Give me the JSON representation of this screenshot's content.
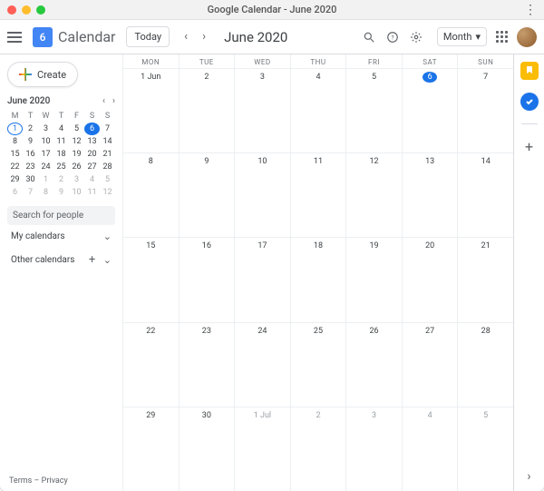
{
  "window": {
    "title": "Google Calendar - June 2020"
  },
  "header": {
    "logo_day": "6",
    "app_name": "Calendar",
    "today_label": "Today",
    "month_title": "June 2020",
    "view_label": "Month"
  },
  "create": {
    "label": "Create"
  },
  "mini": {
    "month_label": "June 2020",
    "dow": [
      "M",
      "T",
      "W",
      "T",
      "F",
      "S",
      "S"
    ],
    "cells": [
      {
        "n": "1",
        "type": "today-outline"
      },
      {
        "n": "2"
      },
      {
        "n": "3"
      },
      {
        "n": "4"
      },
      {
        "n": "5"
      },
      {
        "n": "6",
        "type": "sel"
      },
      {
        "n": "7"
      },
      {
        "n": "8"
      },
      {
        "n": "9"
      },
      {
        "n": "10"
      },
      {
        "n": "11"
      },
      {
        "n": "12"
      },
      {
        "n": "13"
      },
      {
        "n": "14"
      },
      {
        "n": "15"
      },
      {
        "n": "16"
      },
      {
        "n": "17"
      },
      {
        "n": "18"
      },
      {
        "n": "19"
      },
      {
        "n": "20"
      },
      {
        "n": "21"
      },
      {
        "n": "22"
      },
      {
        "n": "23"
      },
      {
        "n": "24"
      },
      {
        "n": "25"
      },
      {
        "n": "26"
      },
      {
        "n": "27"
      },
      {
        "n": "28"
      },
      {
        "n": "29"
      },
      {
        "n": "30"
      },
      {
        "n": "1",
        "type": "dim"
      },
      {
        "n": "2",
        "type": "dim"
      },
      {
        "n": "3",
        "type": "dim"
      },
      {
        "n": "4",
        "type": "dim"
      },
      {
        "n": "5",
        "type": "dim"
      },
      {
        "n": "6",
        "type": "dim"
      },
      {
        "n": "7",
        "type": "dim"
      },
      {
        "n": "8",
        "type": "dim"
      },
      {
        "n": "9",
        "type": "dim"
      },
      {
        "n": "10",
        "type": "dim"
      },
      {
        "n": "11",
        "type": "dim"
      },
      {
        "n": "12",
        "type": "dim"
      }
    ]
  },
  "search_people": {
    "placeholder": "Search for people"
  },
  "sections": {
    "my_cal": "My calendars",
    "other_cal": "Other calendars"
  },
  "footer": {
    "terms": "Terms",
    "privacy": "Privacy",
    "sep": " – "
  },
  "grid": {
    "dow": [
      "MON",
      "TUE",
      "WED",
      "THU",
      "FRI",
      "SAT",
      "SUN"
    ],
    "rows": [
      [
        {
          "n": "1 Jun"
        },
        {
          "n": "2"
        },
        {
          "n": "3"
        },
        {
          "n": "4"
        },
        {
          "n": "5"
        },
        {
          "n": "6",
          "sel": true
        },
        {
          "n": "7"
        }
      ],
      [
        {
          "n": "8"
        },
        {
          "n": "9"
        },
        {
          "n": "10"
        },
        {
          "n": "11"
        },
        {
          "n": "12"
        },
        {
          "n": "13"
        },
        {
          "n": "14"
        }
      ],
      [
        {
          "n": "15"
        },
        {
          "n": "16"
        },
        {
          "n": "17"
        },
        {
          "n": "18"
        },
        {
          "n": "19"
        },
        {
          "n": "20"
        },
        {
          "n": "21"
        }
      ],
      [
        {
          "n": "22"
        },
        {
          "n": "23"
        },
        {
          "n": "24"
        },
        {
          "n": "25"
        },
        {
          "n": "26"
        },
        {
          "n": "27"
        },
        {
          "n": "28"
        }
      ],
      [
        {
          "n": "29"
        },
        {
          "n": "30"
        },
        {
          "n": "1 Jul",
          "dim": true
        },
        {
          "n": "2",
          "dim": true
        },
        {
          "n": "3",
          "dim": true
        },
        {
          "n": "4",
          "dim": true
        },
        {
          "n": "5",
          "dim": true
        }
      ]
    ]
  }
}
